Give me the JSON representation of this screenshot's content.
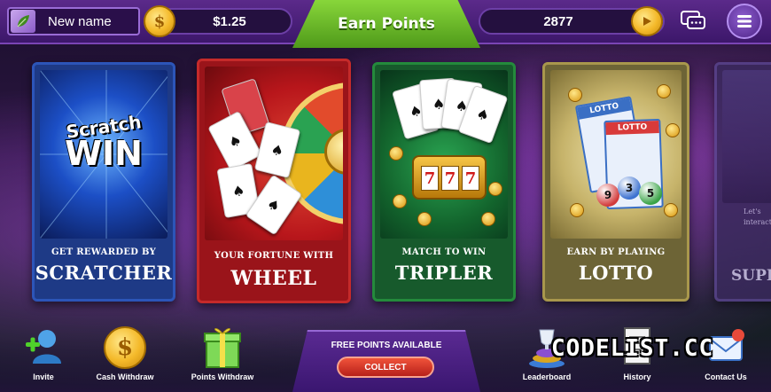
{
  "header": {
    "profile_name": "New name",
    "cash_balance": "$1.25",
    "tab_title": "Earn Points",
    "points_balance": "2877",
    "icons": [
      "leaf-icon",
      "dollar-coin-icon",
      "play-coin-icon",
      "chat-icon",
      "menu-icon"
    ]
  },
  "games": [
    {
      "subtitle": "GET REWARDED BY",
      "title": "SCRATCHER",
      "art_text_1": "Scratch",
      "art_text_2": "WIN"
    },
    {
      "subtitle": "YOUR FORTUNE WITH",
      "title": "WHEEL"
    },
    {
      "subtitle": "MATCH TO WIN",
      "title": "TRIPLER",
      "reels": [
        "7",
        "7",
        "7"
      ]
    },
    {
      "subtitle": "EARN BY PLAYING",
      "title": "LOTTO",
      "ticket_1": "LOTTO",
      "ticket_2": "LOTTO",
      "balls": [
        "9",
        "3",
        "5"
      ]
    }
  ],
  "partial_card": {
    "text": "Let's interact",
    "title": "SUPP"
  },
  "bottom_nav": {
    "invite": "Invite",
    "cash_withdraw": "Cash Withdraw",
    "points_withdraw": "Points Withdraw",
    "free_points": "FREE POINTS AVAILABLE",
    "collect": "COLLECT",
    "leaderboard": "Leaderboard",
    "history": "History",
    "contact_us": "Contact Us"
  },
  "watermark": "CODELIST.CC",
  "colors": {
    "accent_green": "#6bbf2a",
    "coin_gold": "#f4b92a",
    "collect_red": "#d8382a",
    "topbar_purple": "#4a1f78"
  }
}
